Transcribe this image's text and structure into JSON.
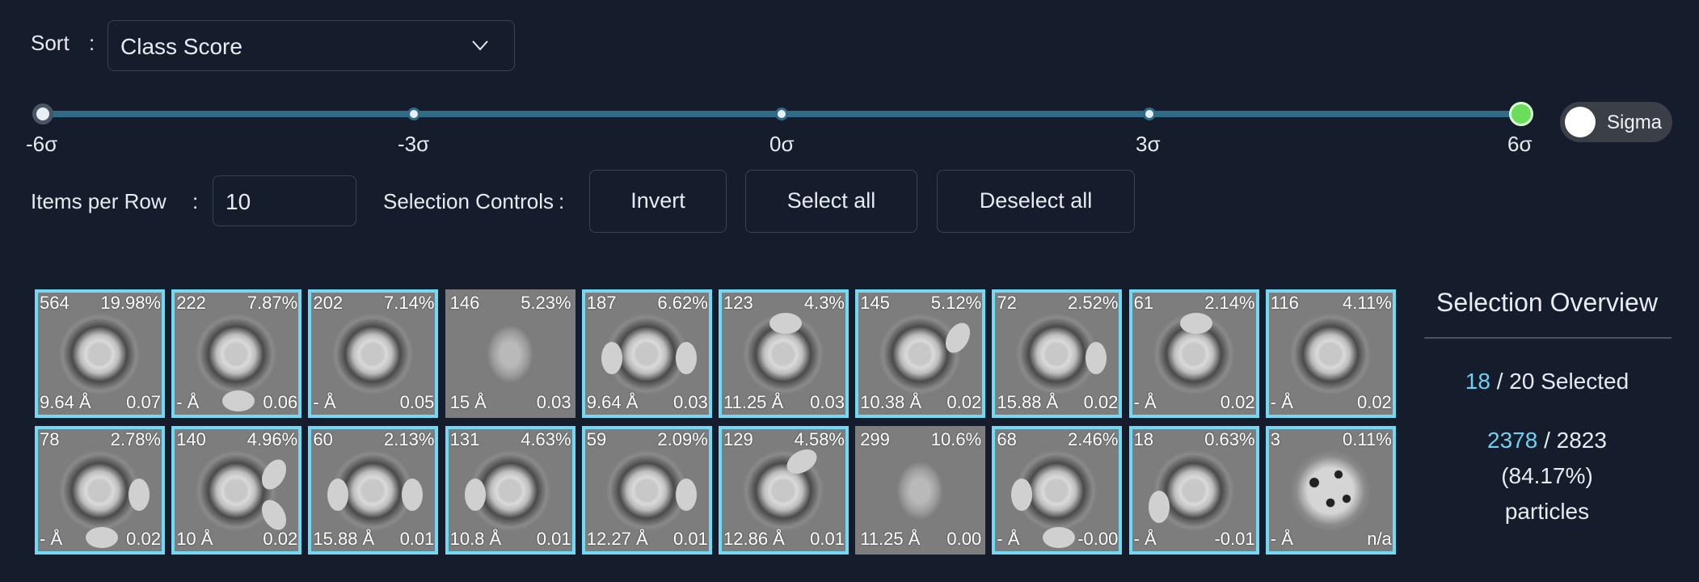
{
  "sort": {
    "label": "Sort",
    "colon": ":",
    "value": "Class Score"
  },
  "slider": {
    "ticks": [
      "-6σ",
      "-3σ",
      "0σ",
      "3σ",
      "6σ"
    ],
    "range_min": -6,
    "range_max": 6,
    "selected_min": -6,
    "selected_max": 6
  },
  "toggle": {
    "label": "Sigma",
    "state": "off"
  },
  "items_per_row": {
    "label": "Items per Row",
    "colon": ":",
    "value": "10"
  },
  "selection_controls": {
    "label": "Selection Controls",
    "colon": ":",
    "invert": "Invert",
    "select_all": "Select all",
    "deselect_all": "Deselect all"
  },
  "classes": [
    {
      "count": "564",
      "pct": "19.98%",
      "res": "9.64 Å",
      "score": "0.07",
      "selected": true,
      "img": "ring"
    },
    {
      "count": "222",
      "pct": "7.87%",
      "res": "- Å",
      "score": "0.06",
      "selected": true,
      "img": "ring"
    },
    {
      "count": "202",
      "pct": "7.14%",
      "res": "- Å",
      "score": "0.05",
      "selected": true,
      "img": "ring"
    },
    {
      "count": "146",
      "pct": "5.23%",
      "res": "15 Å",
      "score": "0.03",
      "selected": false,
      "img": "fuzzy"
    },
    {
      "count": "187",
      "pct": "6.62%",
      "res": "9.64 Å",
      "score": "0.03",
      "selected": true,
      "img": "ring"
    },
    {
      "count": "123",
      "pct": "4.3%",
      "res": "11.25 Å",
      "score": "0.03",
      "selected": true,
      "img": "ring"
    },
    {
      "count": "145",
      "pct": "5.12%",
      "res": "10.38 Å",
      "score": "0.02",
      "selected": true,
      "img": "ring"
    },
    {
      "count": "72",
      "pct": "2.52%",
      "res": "15.88 Å",
      "score": "0.02",
      "selected": true,
      "img": "ring"
    },
    {
      "count": "61",
      "pct": "2.14%",
      "res": "- Å",
      "score": "0.02",
      "selected": true,
      "img": "ring"
    },
    {
      "count": "116",
      "pct": "4.11%",
      "res": "- Å",
      "score": "0.02",
      "selected": true,
      "img": "ring"
    },
    {
      "count": "78",
      "pct": "2.78%",
      "res": "- Å",
      "score": "0.02",
      "selected": true,
      "img": "ring"
    },
    {
      "count": "140",
      "pct": "4.96%",
      "res": "10 Å",
      "score": "0.02",
      "selected": true,
      "img": "ring"
    },
    {
      "count": "60",
      "pct": "2.13%",
      "res": "15.88 Å",
      "score": "0.01",
      "selected": true,
      "img": "ring"
    },
    {
      "count": "131",
      "pct": "4.63%",
      "res": "10.8 Å",
      "score": "0.01",
      "selected": true,
      "img": "ring"
    },
    {
      "count": "59",
      "pct": "2.09%",
      "res": "12.27 Å",
      "score": "0.01",
      "selected": true,
      "img": "ring"
    },
    {
      "count": "129",
      "pct": "4.58%",
      "res": "12.86 Å",
      "score": "0.01",
      "selected": true,
      "img": "ring"
    },
    {
      "count": "299",
      "pct": "10.6%",
      "res": "11.25 Å",
      "score": "0.00",
      "selected": false,
      "img": "fuzzy"
    },
    {
      "count": "68",
      "pct": "2.46%",
      "res": "- Å",
      "score": "-0.00",
      "selected": true,
      "img": "ring"
    },
    {
      "count": "18",
      "pct": "0.63%",
      "res": "- Å",
      "score": "-0.01",
      "selected": true,
      "img": "ring"
    },
    {
      "count": "3",
      "pct": "0.11%",
      "res": "- Å",
      "score": "n/a",
      "selected": true,
      "img": "speckle"
    }
  ],
  "overview": {
    "title": "Selection Overview",
    "selected_count": "18",
    "selected_rest": " / 20 Selected",
    "particles_selected": "2378",
    "particles_rest": " / 2823",
    "percent": "(84.17%)",
    "particles_label": "particles"
  },
  "colors": {
    "background": "#151c2b",
    "accent": "#6fd0f1",
    "tile_border": "#71d9f4",
    "slider_end": "#6bdc5c"
  }
}
